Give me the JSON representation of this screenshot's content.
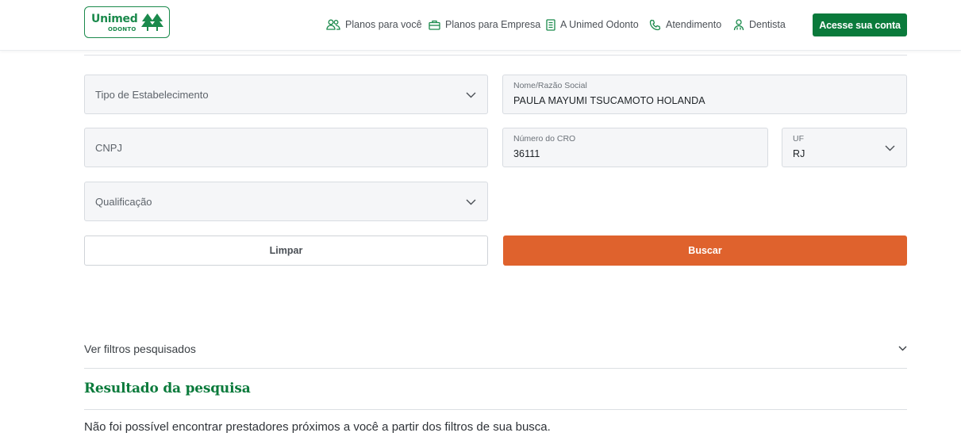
{
  "header": {
    "logo": {
      "brand": "Unimed",
      "sub": "ODONTO"
    },
    "nav": [
      {
        "label": "Planos para você",
        "icon": "people-icon"
      },
      {
        "label": "Planos para Empresa",
        "icon": "briefcase-icon"
      },
      {
        "label": "A Unimed Odonto",
        "icon": "document-icon"
      },
      {
        "label": "Atendimento",
        "icon": "phone-icon"
      },
      {
        "label": "Dentista",
        "icon": "dentist-icon"
      }
    ],
    "account_button": "Acesse sua conta"
  },
  "form": {
    "tipo_estabelecimento": {
      "placeholder": "Tipo de Estabelecimento"
    },
    "nome": {
      "label": "Nome/Razão Social",
      "value": "PAULA MAYUMI TSUCAMOTO HOLANDA"
    },
    "cnpj": {
      "placeholder": "CNPJ"
    },
    "cro": {
      "label": "Número do CRO",
      "value": "36111"
    },
    "uf": {
      "label": "UF",
      "value": "RJ"
    },
    "qualificacao": {
      "placeholder": "Qualificação"
    },
    "clear_button": "Limpar",
    "search_button": "Buscar"
  },
  "results": {
    "filters_toggle": "Ver filtros pesquisados",
    "title": "Resultado da pesquisa",
    "message": "Não foi possível encontrar prestadores próximos a você a partir dos filtros de sua busca."
  },
  "colors": {
    "brand_green": "#0a7a3b",
    "accent_orange": "#df622d",
    "field_bg": "#f5f6f8"
  }
}
